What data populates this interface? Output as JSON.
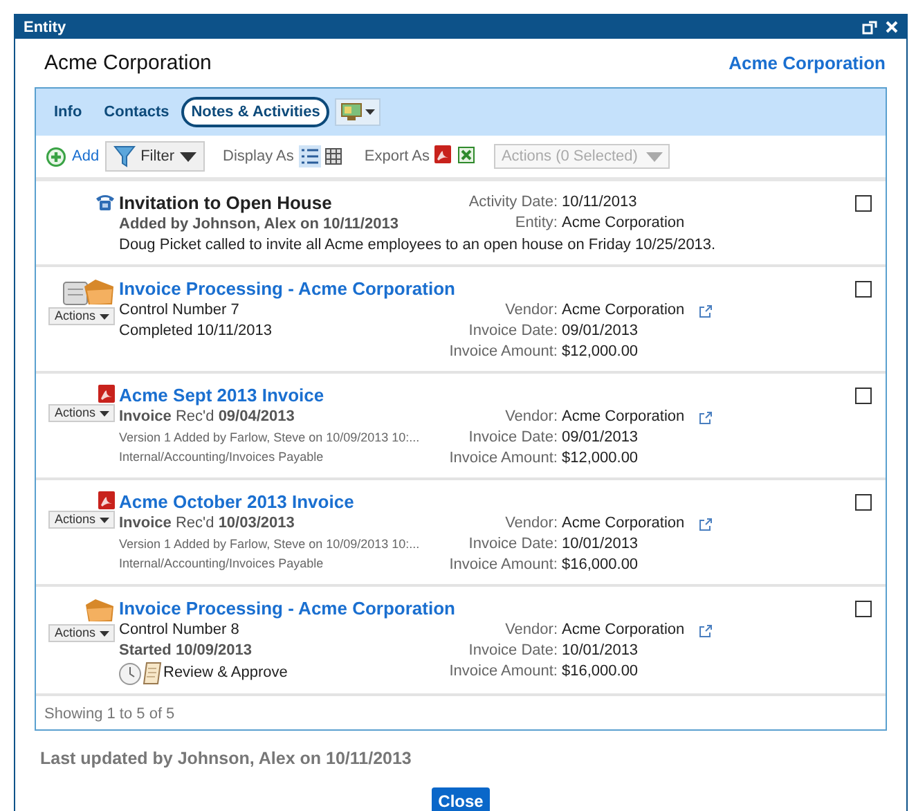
{
  "window": {
    "title": "Entity"
  },
  "header": {
    "title": "Acme Corporation",
    "link": "Acme Corporation"
  },
  "tabs": [
    {
      "label": "Info",
      "selected": false
    },
    {
      "label": "Contacts",
      "selected": false
    },
    {
      "label": "Notes & Activities",
      "selected": true
    }
  ],
  "toolbar": {
    "add": "Add",
    "filter": "Filter",
    "display_as": "Display As",
    "views": [
      {
        "kind": "list",
        "selected": true
      },
      {
        "kind": "grid",
        "selected": false
      }
    ],
    "export_as": "Export As",
    "exports": [
      {
        "kind": "pdf"
      },
      {
        "kind": "excel"
      }
    ],
    "actions": {
      "label": "Actions (0 Selected)",
      "disabled": true
    }
  },
  "items": [
    {
      "kind": "activity",
      "title": "Invitation to Open House",
      "lines": [
        {
          "kind": "bold",
          "text": "Added by Johnson, Alex on 10/11/2013"
        }
      ],
      "description": "Doug Picket called to invite all Acme employees to an open house on Friday 10/25/2013.",
      "fields": [
        {
          "kind": "text",
          "label": "Activity Date:",
          "value": "10/11/2013"
        },
        {
          "kind": "text",
          "label": "Entity:",
          "value": "Acme Corporation"
        }
      ],
      "checked": false
    },
    {
      "kind": "task",
      "actions": "Actions",
      "title": "Invoice Processing - Acme Corporation",
      "lines": [
        {
          "kind": "normal",
          "text": "Control Number 7"
        },
        {
          "kind": "normal",
          "text": "Completed 10/11/2013"
        }
      ],
      "fields": [
        {
          "kind": "link",
          "label": "Vendor:",
          "value": "Acme Corporation"
        },
        {
          "kind": "text",
          "label": "Invoice Date:",
          "value": "09/01/2013"
        },
        {
          "kind": "text",
          "label": "Invoice Amount:",
          "value": "$12,000.00"
        }
      ],
      "checked": false
    },
    {
      "kind": "document",
      "actions": "Actions",
      "title": "Acme Sept 2013 Invoice",
      "lines": [
        {
          "kind": "rich",
          "text": "**Invoice** Rec'd **09/04/2013**"
        },
        {
          "kind": "small",
          "text": "Version 1 Added by Farlow, Steve on 10/09/2013 10:..."
        },
        {
          "kind": "small",
          "text": "Internal/Accounting/Invoices Payable"
        }
      ],
      "fields": [
        {
          "kind": "link",
          "label": "Vendor:",
          "value": "Acme Corporation"
        },
        {
          "kind": "text",
          "label": "Invoice Date:",
          "value": "09/01/2013"
        },
        {
          "kind": "text",
          "label": "Invoice Amount:",
          "value": "$12,000.00"
        }
      ],
      "checked": false
    },
    {
      "kind": "document",
      "actions": "Actions",
      "title": "Acme October 2013 Invoice",
      "lines": [
        {
          "kind": "rich",
          "text": "**Invoice** Rec'd **10/03/2013**"
        },
        {
          "kind": "small",
          "text": "Version 1 Added by Farlow, Steve on 10/09/2013 10:..."
        },
        {
          "kind": "small",
          "text": "Internal/Accounting/Invoices Payable"
        }
      ],
      "fields": [
        {
          "kind": "link",
          "label": "Vendor:",
          "value": "Acme Corporation"
        },
        {
          "kind": "text",
          "label": "Invoice Date:",
          "value": "10/01/2013"
        },
        {
          "kind": "text",
          "label": "Invoice Amount:",
          "value": "$16,000.00"
        }
      ],
      "checked": false
    },
    {
      "kind": "workflow",
      "actions": "Actions",
      "title": "Invoice Processing - Acme Corporation",
      "lines": [
        {
          "kind": "normal",
          "text": "Control Number 8"
        },
        {
          "kind": "bold",
          "text": "Started 10/09/2013"
        },
        {
          "kind": "step",
          "text": "Review & Approve"
        }
      ],
      "fields": [
        {
          "kind": "link",
          "label": "Vendor:",
          "value": "Acme Corporation"
        },
        {
          "kind": "text",
          "label": "Invoice Date:",
          "value": "10/01/2013"
        },
        {
          "kind": "text",
          "label": "Invoice Amount:",
          "value": "$16,000.00"
        }
      ],
      "checked": false
    }
  ],
  "footer": "Showing 1 to 5 of 5",
  "last_updated": "Last updated by Johnson, Alex on 10/11/2013",
  "buttons": [
    {
      "label": "Close"
    }
  ]
}
